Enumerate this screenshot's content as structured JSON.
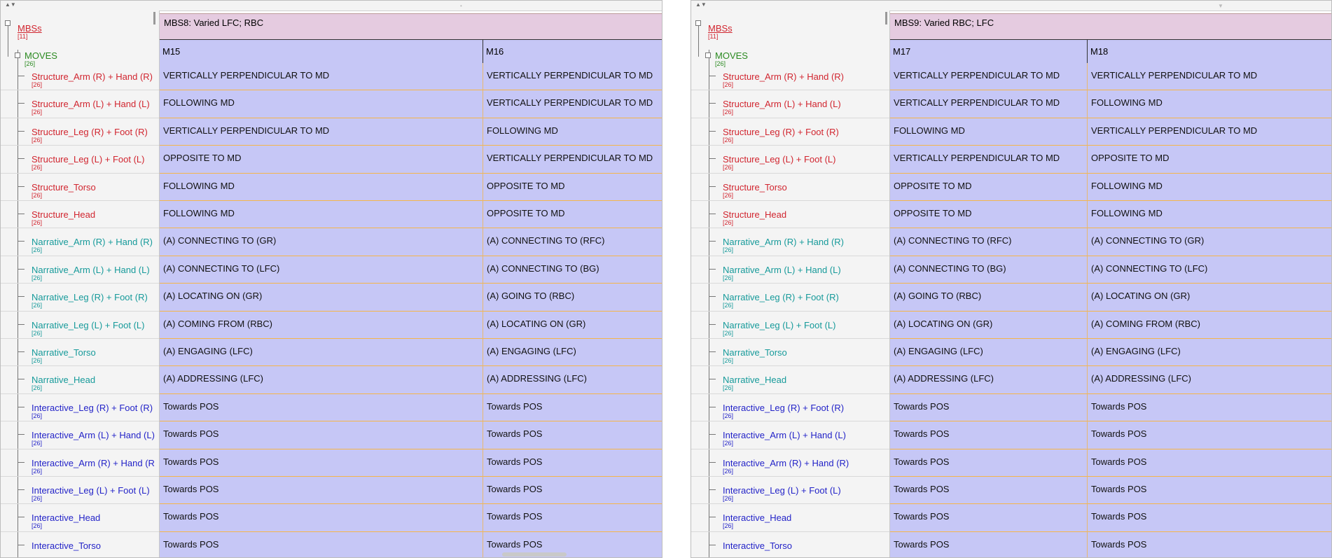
{
  "colors": {
    "mbs_label": "#d1252f",
    "moves_label": "#2b8a21",
    "structure": "#d1252f",
    "narrative": "#169a9a",
    "interactive": "#2323c8",
    "cell_bg": "#c6c7f6",
    "mbs_header_bg": "#e5cbe0",
    "row_line": "#f5b54a"
  },
  "panels": [
    {
      "tree": {
        "mbs": {
          "label": "MBSs",
          "count": "[11]"
        },
        "moves": {
          "label": "MOVES",
          "count": "[26]"
        },
        "rows": [
          {
            "label": "Structure_Arm (R) + Hand (R)",
            "count": "[26]",
            "kind": "structure"
          },
          {
            "label": "Structure_Arm (L) + Hand (L)",
            "count": "[26]",
            "kind": "structure"
          },
          {
            "label": "Structure_Leg (R) + Foot (R)",
            "count": "[26]",
            "kind": "structure"
          },
          {
            "label": "Structure_Leg (L) + Foot (L)",
            "count": "[26]",
            "kind": "structure"
          },
          {
            "label": "Structure_Torso",
            "count": "[26]",
            "kind": "structure"
          },
          {
            "label": "Structure_Head",
            "count": "[26]",
            "kind": "structure"
          },
          {
            "label": "Narrative_Arm (R) + Hand (R)",
            "count": "[26]",
            "kind": "narrative"
          },
          {
            "label": "Narrative_Arm (L) + Hand (L)",
            "count": "[26]",
            "kind": "narrative"
          },
          {
            "label": "Narrative_Leg (R) + Foot (R)",
            "count": "[26]",
            "kind": "narrative"
          },
          {
            "label": "Narrative_Leg (L) + Foot (L)",
            "count": "[26]",
            "kind": "narrative"
          },
          {
            "label": "Narrative_Torso",
            "count": "[26]",
            "kind": "narrative"
          },
          {
            "label": "Narrative_Head",
            "count": "[26]",
            "kind": "narrative"
          },
          {
            "label": "Interactive_Leg (R) + Foot (R)",
            "count": "[26]",
            "kind": "interactive"
          },
          {
            "label": "Interactive_Arm (L) + Hand (L)",
            "count": "[26]",
            "kind": "interactive"
          },
          {
            "label": "Interactive_Arm (R) + Hand (R",
            "count": "[26]",
            "kind": "interactive"
          },
          {
            "label": "Interactive_Leg (L) + Foot (L)",
            "count": "[26]",
            "kind": "interactive"
          },
          {
            "label": "Interactive_Head",
            "count": "[26]",
            "kind": "interactive"
          },
          {
            "label": "Interactive_Torso",
            "count": "",
            "kind": "interactive"
          }
        ]
      },
      "mbs_title": "MBS8: Varied LFC; RBC",
      "moves": [
        {
          "label": "M15",
          "cells": [
            "VERTICALLY PERPENDICULAR TO MD",
            "FOLLOWING MD",
            "VERTICALLY PERPENDICULAR TO MD",
            "OPPOSITE TO MD",
            "FOLLOWING MD",
            "FOLLOWING MD",
            "(A) CONNECTING TO (GR)",
            "(A) CONNECTING TO (LFC)",
            "(A) LOCATING ON (GR)",
            "(A) COMING FROM (RBC)",
            "(A) ENGAGING (LFC)",
            "(A) ADDRESSING (LFC)",
            "Towards POS",
            "Towards POS",
            "Towards POS",
            "Towards POS",
            "Towards POS",
            "Towards POS"
          ]
        },
        {
          "label": "M16",
          "cells": [
            "VERTICALLY PERPENDICULAR TO MD",
            "VERTICALLY PERPENDICULAR TO MD",
            "FOLLOWING MD",
            "VERTICALLY PERPENDICULAR TO MD",
            "OPPOSITE TO MD",
            "OPPOSITE TO MD",
            "(A) CONNECTING TO (RFC)",
            "(A) CONNECTING TO (BG)",
            "(A) GOING TO (RBC)",
            "(A) LOCATING ON (GR)",
            "(A) ENGAGING (LFC)",
            "(A) ADDRESSING (LFC)",
            "Towards POS",
            "Towards POS",
            "Towards POS",
            "Towards POS",
            "Towards POS",
            "Towards POS"
          ]
        }
      ]
    },
    {
      "tree": {
        "mbs": {
          "label": "MBSs",
          "count": "[11]"
        },
        "moves": {
          "label": "MOVES",
          "count": "[26]"
        },
        "rows": [
          {
            "label": "Structure_Arm (R) + Hand (R)",
            "count": "[26]",
            "kind": "structure"
          },
          {
            "label": "Structure_Arm (L) + Hand (L)",
            "count": "[26]",
            "kind": "structure"
          },
          {
            "label": "Structure_Leg (R) + Foot (R)",
            "count": "[26]",
            "kind": "structure"
          },
          {
            "label": "Structure_Leg (L) + Foot (L)",
            "count": "[26]",
            "kind": "structure"
          },
          {
            "label": "Structure_Torso",
            "count": "[26]",
            "kind": "structure"
          },
          {
            "label": "Structure_Head",
            "count": "[26]",
            "kind": "structure"
          },
          {
            "label": "Narrative_Arm (R) + Hand (R)",
            "count": "[26]",
            "kind": "narrative"
          },
          {
            "label": "Narrative_Arm (L) + Hand (L)",
            "count": "[26]",
            "kind": "narrative"
          },
          {
            "label": "Narrative_Leg (R) + Foot (R)",
            "count": "[26]",
            "kind": "narrative"
          },
          {
            "label": "Narrative_Leg (L) + Foot (L)",
            "count": "[26]",
            "kind": "narrative"
          },
          {
            "label": "Narrative_Torso",
            "count": "[26]",
            "kind": "narrative"
          },
          {
            "label": "Narrative_Head",
            "count": "[26]",
            "kind": "narrative"
          },
          {
            "label": "Interactive_Leg (R) + Foot (R)",
            "count": "[26]",
            "kind": "interactive"
          },
          {
            "label": "Interactive_Arm (L) + Hand (L)",
            "count": "[26]",
            "kind": "interactive"
          },
          {
            "label": "Interactive_Arm (R) + Hand (R)",
            "count": "[26]",
            "kind": "interactive"
          },
          {
            "label": "Interactive_Leg (L) + Foot (L)",
            "count": "[26]",
            "kind": "interactive"
          },
          {
            "label": "Interactive_Head",
            "count": "[26]",
            "kind": "interactive"
          },
          {
            "label": "Interactive_Torso",
            "count": "",
            "kind": "interactive"
          }
        ]
      },
      "mbs_title": "MBS9: Varied RBC; LFC",
      "moves": [
        {
          "label": "M17",
          "cells": [
            "VERTICALLY PERPENDICULAR TO MD",
            "VERTICALLY PERPENDICULAR TO MD",
            "FOLLOWING MD",
            "VERTICALLY PERPENDICULAR TO MD",
            "OPPOSITE TO MD",
            "OPPOSITE TO MD",
            "(A) CONNECTING TO (RFC)",
            "(A) CONNECTING TO (BG)",
            "(A) GOING TO (RBC)",
            "(A) LOCATING ON (GR)",
            "(A) ENGAGING (LFC)",
            "(A) ADDRESSING (LFC)",
            "Towards POS",
            "Towards POS",
            "Towards POS",
            "Towards POS",
            "Towards POS",
            "Towards POS"
          ]
        },
        {
          "label": "M18",
          "cells": [
            "VERTICALLY PERPENDICULAR TO MD",
            "FOLLOWING MD",
            "VERTICALLY PERPENDICULAR TO MD",
            "OPPOSITE TO MD",
            "FOLLOWING MD",
            "FOLLOWING MD",
            "(A) CONNECTING TO (GR)",
            "(A) CONNECTING TO (LFC)",
            "(A) LOCATING ON (GR)",
            "(A) COMING FROM (RBC)",
            "(A) ENGAGING (LFC)",
            "(A) ADDRESSING (LFC)",
            "Towards POS",
            "Towards POS",
            "Towards POS",
            "Towards POS",
            "Towards POS",
            "Towards POS"
          ]
        }
      ]
    }
  ]
}
